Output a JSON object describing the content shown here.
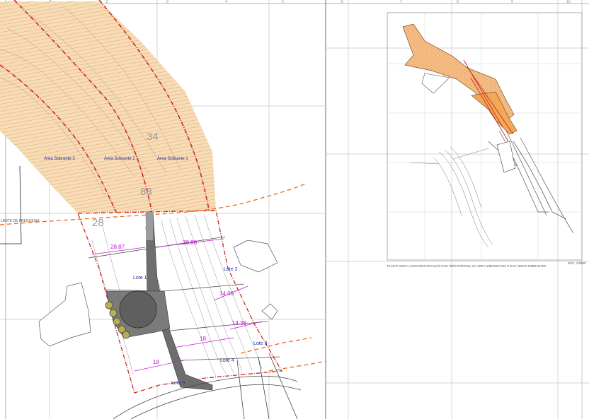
{
  "main_map": {
    "areas": [
      {
        "label": "Área Sobrante 3"
      },
      {
        "label": "Área Sobrante 2"
      },
      {
        "label": "Área Sobrante 1"
      }
    ],
    "parcel_numbers": [
      "34",
      "88",
      "28"
    ],
    "lots": [
      {
        "label": "Lote 1"
      },
      {
        "label": "Lote 2"
      },
      {
        "label": "Lote 3"
      },
      {
        "label": "Lote 4"
      },
      {
        "label": "Lote 5"
      }
    ],
    "dimensions": [
      "28.87",
      "38.88",
      "14.06",
      "14.38",
      "18",
      "18"
    ],
    "boundary_label": "LIMITE DE FREGUESIA",
    "grid_numbers": [
      "1",
      "2",
      "3",
      "4",
      "5"
    ]
  },
  "inset_map": {
    "caption": "PLANTA GERAL COM IDENTIFICAÇÃO DOS TRÊS PRÉDIOS, DA ÁREA URBANIZÁVEL E DAS ÁREAS SOBRANTES",
    "scale": "ESC. 1/2500",
    "grid_numbers": [
      "6",
      "7",
      "8",
      "9",
      "10"
    ]
  },
  "colors": {
    "hatch_fill": "#f7dcb8",
    "hatch_line": "#e8b47a",
    "boundary_red": "#c8281e",
    "dashed_orange": "#ee6a1a",
    "label_blue": "#1f2fa8",
    "dimension_magenta": "#c21ad2",
    "inset_orange": "#f39a3a",
    "road_gray": "#6e6e6e"
  }
}
